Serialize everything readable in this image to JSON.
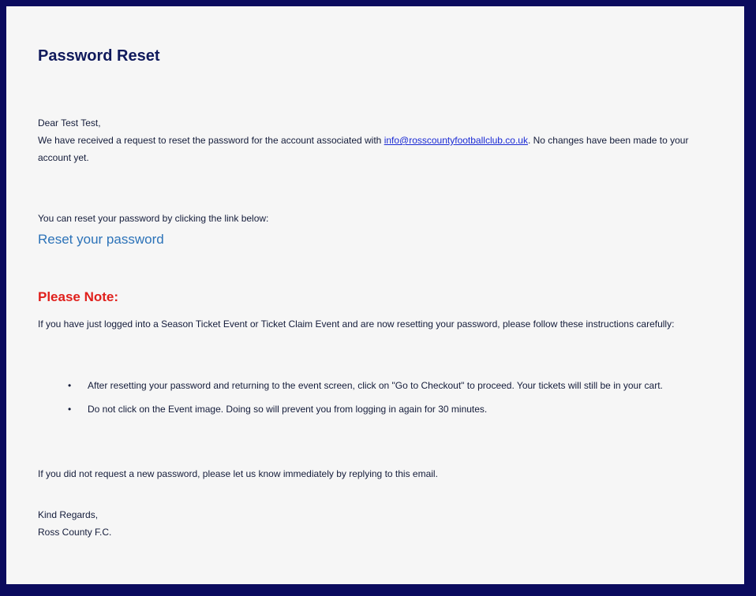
{
  "email": {
    "title": "Password Reset",
    "greeting": "Dear Test Test,",
    "intro_before_link": "We have received a request to reset the password for the account associated with ",
    "account_email": "info@rosscountyfootballclub.co.uk",
    "intro_after_link": ". No changes have been made to your account yet.",
    "reset_instruction": "You can reset your password by clicking the link below:",
    "reset_link_label": "Reset your password",
    "note_heading": "Please Note:",
    "note_text": "If you have just logged into a Season Ticket Event or Ticket Claim Event and are now resetting your password, please follow these instructions carefully:",
    "instructions": [
      "After resetting your password and returning to the event screen, click on \"Go to Checkout\" to proceed. Your tickets will still be in your cart.",
      "Do not click on the Event image. Doing so will prevent you from logging in again for 30 minutes."
    ],
    "bullet_glyph": "•",
    "not_requested": "If you did not request a new password, please let us know immediately by replying to this email.",
    "signoff": "Kind Regards,",
    "signature": "Ross County F.C."
  },
  "colors": {
    "page_background": "#0b0b5e",
    "card_background": "#f6f6f6",
    "title": "#101a5c",
    "link": "#1a2ad4",
    "reset_link": "#2b72b8",
    "note_heading": "#e0201c"
  }
}
